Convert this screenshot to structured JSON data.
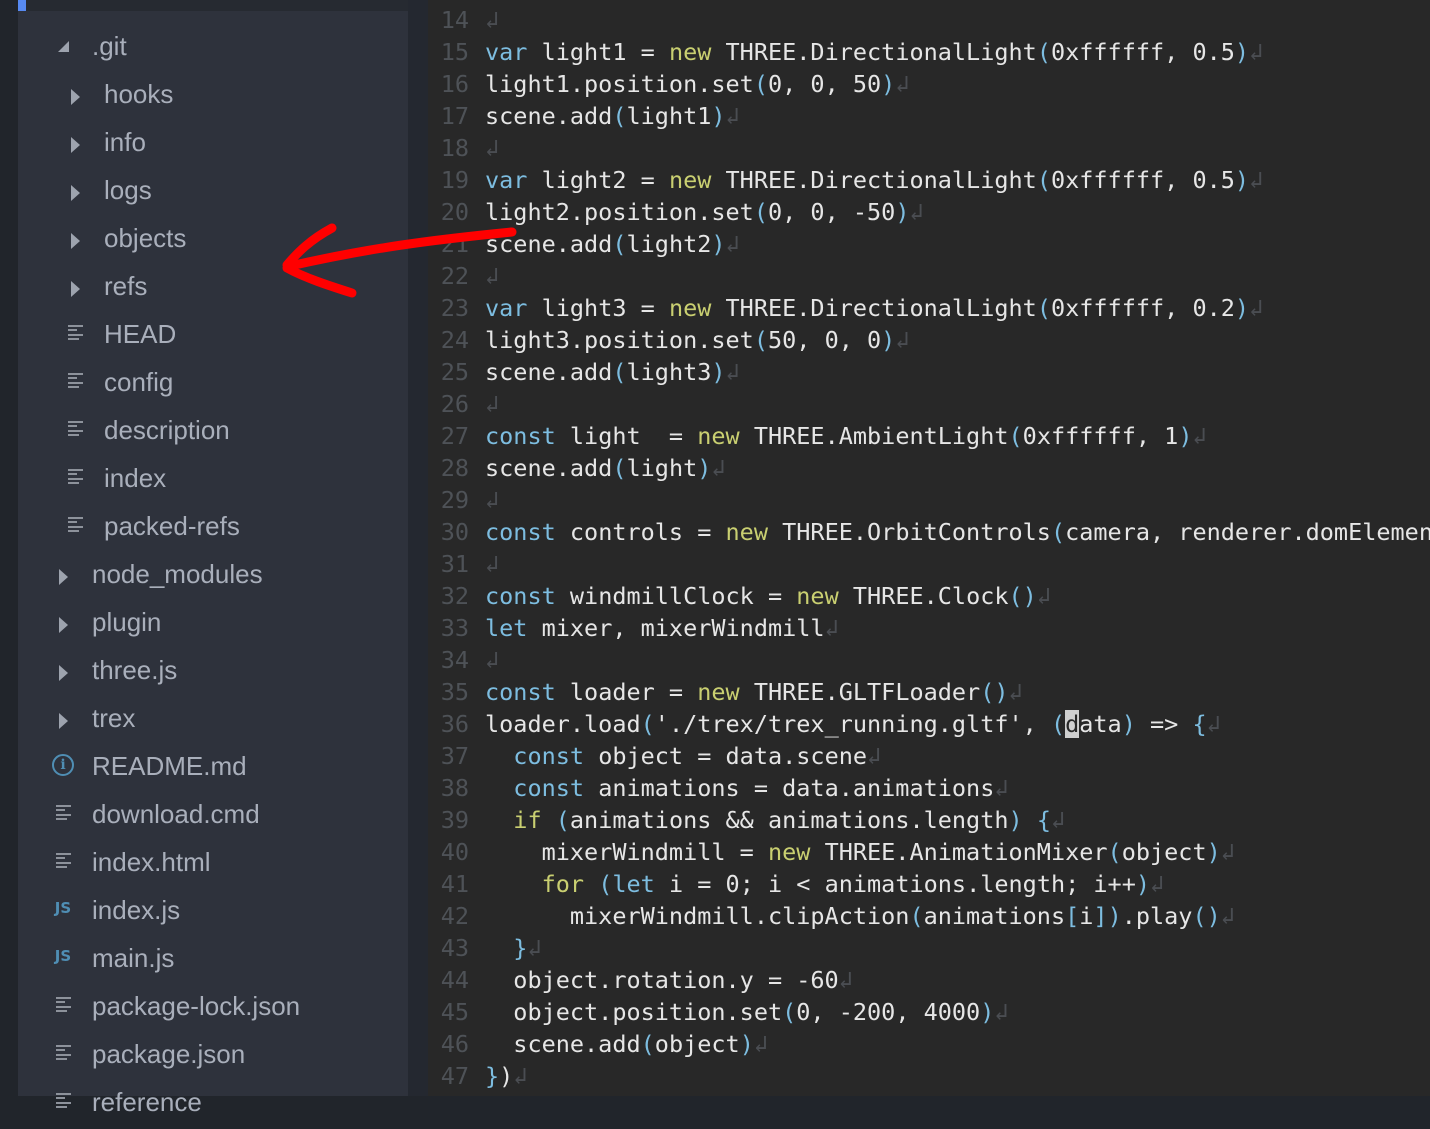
{
  "sidebar": {
    "items": [
      {
        "label": ".git",
        "type": "folder-open",
        "indent": 0
      },
      {
        "label": "hooks",
        "type": "folder",
        "indent": 1
      },
      {
        "label": "info",
        "type": "folder",
        "indent": 1
      },
      {
        "label": "logs",
        "type": "folder",
        "indent": 1
      },
      {
        "label": "objects",
        "type": "folder",
        "indent": 1
      },
      {
        "label": "refs",
        "type": "folder",
        "indent": 1
      },
      {
        "label": "HEAD",
        "type": "file",
        "indent": 1
      },
      {
        "label": "config",
        "type": "file",
        "indent": 1
      },
      {
        "label": "description",
        "type": "file",
        "indent": 1
      },
      {
        "label": "index",
        "type": "file",
        "indent": 1
      },
      {
        "label": "packed-refs",
        "type": "file",
        "indent": 1
      },
      {
        "label": "node_modules",
        "type": "folder",
        "indent": 0
      },
      {
        "label": "plugin",
        "type": "folder",
        "indent": 0
      },
      {
        "label": "three.js",
        "type": "folder",
        "indent": 0
      },
      {
        "label": "trex",
        "type": "folder",
        "indent": 0
      },
      {
        "label": "README.md",
        "type": "info",
        "indent": 0
      },
      {
        "label": "download.cmd",
        "type": "file",
        "indent": 0
      },
      {
        "label": "index.html",
        "type": "file",
        "indent": 0
      },
      {
        "label": "index.js",
        "type": "js",
        "indent": 0
      },
      {
        "label": "main.js",
        "type": "js",
        "indent": 0
      },
      {
        "label": "package-lock.json",
        "type": "file",
        "indent": 0
      },
      {
        "label": "package.json",
        "type": "file",
        "indent": 0
      },
      {
        "label": "reference",
        "type": "file",
        "indent": 0
      }
    ],
    "icons": {
      "js_label": "JS",
      "info_label": "i"
    }
  },
  "editor": {
    "eol_glyph": "↲",
    "lines": [
      {
        "n": "14",
        "tokens": []
      },
      {
        "n": "15",
        "tokens": [
          [
            "kw",
            "var"
          ],
          [
            "t",
            " light1 = "
          ],
          [
            "nw",
            "new"
          ],
          [
            "t",
            " THREE.DirectionalLight"
          ],
          [
            "pn",
            "("
          ],
          [
            "t",
            "0xffffff, 0.5"
          ],
          [
            "pn",
            ")"
          ]
        ]
      },
      {
        "n": "16",
        "tokens": [
          [
            "t",
            "light1.position.set"
          ],
          [
            "pn",
            "("
          ],
          [
            "t",
            "0, 0, 50"
          ],
          [
            "pn",
            ")"
          ]
        ]
      },
      {
        "n": "17",
        "tokens": [
          [
            "t",
            "scene.add"
          ],
          [
            "pn",
            "("
          ],
          [
            "t",
            "light1"
          ],
          [
            "pn",
            ")"
          ]
        ]
      },
      {
        "n": "18",
        "tokens": []
      },
      {
        "n": "19",
        "tokens": [
          [
            "kw",
            "var"
          ],
          [
            "t",
            " light2 = "
          ],
          [
            "nw",
            "new"
          ],
          [
            "t",
            " THREE.DirectionalLight"
          ],
          [
            "pn",
            "("
          ],
          [
            "t",
            "0xffffff, 0.5"
          ],
          [
            "pn",
            ")"
          ]
        ]
      },
      {
        "n": "20",
        "tokens": [
          [
            "t",
            "light2.position.set"
          ],
          [
            "pn",
            "("
          ],
          [
            "t",
            "0, 0, -50"
          ],
          [
            "pn",
            ")"
          ]
        ]
      },
      {
        "n": "21",
        "tokens": [
          [
            "t",
            "scene.add"
          ],
          [
            "pn",
            "("
          ],
          [
            "t",
            "light2"
          ],
          [
            "pn",
            ")"
          ]
        ]
      },
      {
        "n": "22",
        "tokens": []
      },
      {
        "n": "23",
        "tokens": [
          [
            "kw",
            "var"
          ],
          [
            "t",
            " light3 = "
          ],
          [
            "nw",
            "new"
          ],
          [
            "t",
            " THREE.DirectionalLight"
          ],
          [
            "pn",
            "("
          ],
          [
            "t",
            "0xffffff, 0.2"
          ],
          [
            "pn",
            ")"
          ]
        ]
      },
      {
        "n": "24",
        "tokens": [
          [
            "t",
            "light3.position.set"
          ],
          [
            "pn",
            "("
          ],
          [
            "t",
            "50, 0, 0"
          ],
          [
            "pn",
            ")"
          ]
        ]
      },
      {
        "n": "25",
        "tokens": [
          [
            "t",
            "scene.add"
          ],
          [
            "pn",
            "("
          ],
          [
            "t",
            "light3"
          ],
          [
            "pn",
            ")"
          ]
        ]
      },
      {
        "n": "26",
        "tokens": []
      },
      {
        "n": "27",
        "tokens": [
          [
            "kw",
            "const"
          ],
          [
            "t",
            " light  = "
          ],
          [
            "nw",
            "new"
          ],
          [
            "t",
            " THREE.AmbientLight"
          ],
          [
            "pn",
            "("
          ],
          [
            "t",
            "0xffffff, 1"
          ],
          [
            "pn",
            ")"
          ]
        ]
      },
      {
        "n": "28",
        "tokens": [
          [
            "t",
            "scene.add"
          ],
          [
            "pn",
            "("
          ],
          [
            "t",
            "light"
          ],
          [
            "pn",
            ")"
          ]
        ]
      },
      {
        "n": "29",
        "tokens": []
      },
      {
        "n": "30",
        "tokens": [
          [
            "kw",
            "const"
          ],
          [
            "t",
            " controls = "
          ],
          [
            "nw",
            "new"
          ],
          [
            "t",
            " THREE.OrbitControls"
          ],
          [
            "pn",
            "("
          ],
          [
            "t",
            "camera, renderer.domElement"
          ],
          [
            "pn",
            ")"
          ]
        ],
        "noeol": true
      },
      {
        "n": "31",
        "tokens": []
      },
      {
        "n": "32",
        "tokens": [
          [
            "kw",
            "const"
          ],
          [
            "t",
            " windmillClock = "
          ],
          [
            "nw",
            "new"
          ],
          [
            "t",
            " THREE.Clock"
          ],
          [
            "pn",
            "()"
          ]
        ]
      },
      {
        "n": "33",
        "tokens": [
          [
            "kw",
            "let"
          ],
          [
            "t",
            " mixer, mixerWindmill"
          ]
        ]
      },
      {
        "n": "34",
        "tokens": []
      },
      {
        "n": "35",
        "tokens": [
          [
            "kw",
            "const"
          ],
          [
            "t",
            " loader = "
          ],
          [
            "nw",
            "new"
          ],
          [
            "t",
            " THREE.GLTFLoader"
          ],
          [
            "pn",
            "()"
          ]
        ]
      },
      {
        "n": "36",
        "tokens": [
          [
            "t",
            "loader.load"
          ],
          [
            "pn",
            "("
          ],
          [
            "t",
            "'./trex/trex_running.gltf', "
          ],
          [
            "pn",
            "("
          ],
          [
            "cur",
            "d"
          ],
          [
            "t",
            "ata"
          ],
          [
            "pn",
            ")"
          ],
          [
            "t",
            " => "
          ],
          [
            "pn",
            "{"
          ]
        ]
      },
      {
        "n": "37",
        "tokens": [
          [
            "t",
            "  "
          ],
          [
            "kw",
            "const"
          ],
          [
            "t",
            " object = data.scene"
          ]
        ]
      },
      {
        "n": "38",
        "tokens": [
          [
            "t",
            "  "
          ],
          [
            "kw",
            "const"
          ],
          [
            "t",
            " animations = data.animations"
          ]
        ]
      },
      {
        "n": "39",
        "tokens": [
          [
            "t",
            "  "
          ],
          [
            "nw",
            "if"
          ],
          [
            "t",
            " "
          ],
          [
            "pn",
            "("
          ],
          [
            "t",
            "animations && animations.length"
          ],
          [
            "pn",
            ")"
          ],
          [
            "t",
            " "
          ],
          [
            "pn",
            "{"
          ]
        ]
      },
      {
        "n": "40",
        "tokens": [
          [
            "t",
            "    mixerWindmill = "
          ],
          [
            "nw",
            "new"
          ],
          [
            "t",
            " THREE.AnimationMixer"
          ],
          [
            "pn",
            "("
          ],
          [
            "t",
            "object"
          ],
          [
            "pn",
            ")"
          ]
        ]
      },
      {
        "n": "41",
        "tokens": [
          [
            "t",
            "    "
          ],
          [
            "nw",
            "for"
          ],
          [
            "t",
            " "
          ],
          [
            "pn",
            "("
          ],
          [
            "kw",
            "let"
          ],
          [
            "t",
            " i = 0; i < animations.length; i++"
          ],
          [
            "pn",
            ")"
          ]
        ]
      },
      {
        "n": "42",
        "tokens": [
          [
            "t",
            "      mixerWindmill.clipAction"
          ],
          [
            "pn",
            "("
          ],
          [
            "t",
            "animations"
          ],
          [
            "pn",
            "["
          ],
          [
            "t",
            "i"
          ],
          [
            "pn",
            "]"
          ],
          [
            "pn",
            ")"
          ],
          [
            "t",
            ".play"
          ],
          [
            "pn",
            "()"
          ]
        ]
      },
      {
        "n": "43",
        "tokens": [
          [
            "t",
            "  "
          ],
          [
            "pn",
            "}"
          ]
        ]
      },
      {
        "n": "44",
        "tokens": [
          [
            "t",
            "  object.rotation.y = -60"
          ]
        ]
      },
      {
        "n": "45",
        "tokens": [
          [
            "t",
            "  object.position.set"
          ],
          [
            "pn",
            "("
          ],
          [
            "t",
            "0, -200, 4000"
          ],
          [
            "pn",
            ")"
          ]
        ]
      },
      {
        "n": "46",
        "tokens": [
          [
            "t",
            "  scene.add"
          ],
          [
            "pn",
            "("
          ],
          [
            "t",
            "object"
          ],
          [
            "pn",
            ")"
          ]
        ]
      },
      {
        "n": "47",
        "tokens": [
          [
            "pn",
            "}"
          ],
          [
            "t",
            ")"
          ]
        ]
      }
    ]
  },
  "annotation": {
    "type": "red-arrow",
    "color": "#ff0000",
    "points_to": "refs"
  }
}
